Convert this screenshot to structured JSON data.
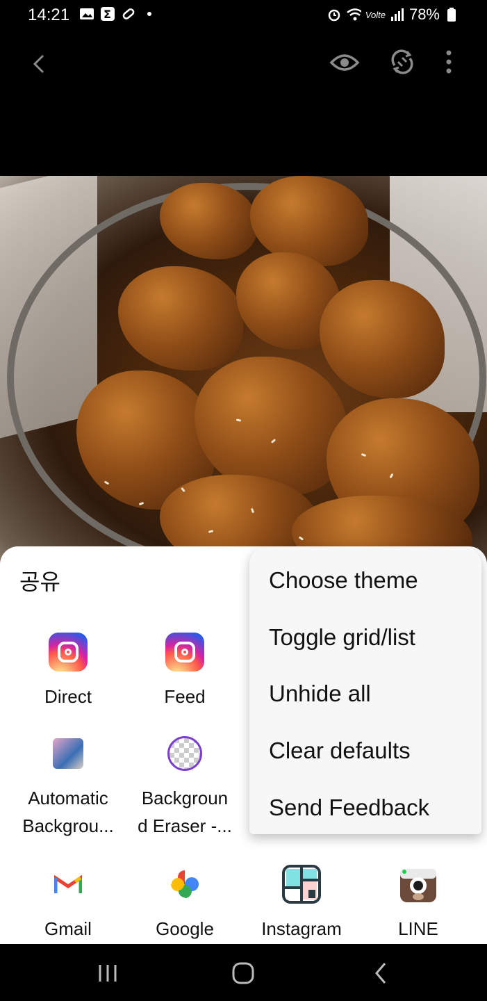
{
  "status_bar": {
    "time": "14:21",
    "battery": "78%",
    "network": "Volte"
  },
  "share_sheet": {
    "title": "공유",
    "apps": [
      {
        "label": "Direct",
        "icon": "instagram-icon"
      },
      {
        "label": "Feed",
        "icon": "instagram-icon"
      },
      {
        "label_line1": "Automatic",
        "label_line2": "Backgrou...",
        "icon": "automatic-background-app-icon"
      },
      {
        "label_line1": "Backgroun",
        "label_line2": "d Eraser -...",
        "icon": "background-eraser-icon"
      },
      {
        "label": "Gmail",
        "icon": "gmail-icon"
      },
      {
        "label": "Google",
        "icon": "google-photos-icon"
      },
      {
        "label": "Instagram",
        "icon": "instagram-layout-icon"
      },
      {
        "label": "LINE",
        "icon": "line-camera-icon"
      }
    ]
  },
  "overflow_menu": {
    "items": [
      "Choose theme",
      "Toggle grid/list",
      "Unhide all",
      "Clear defaults",
      "Send Feedback"
    ]
  },
  "colors": {
    "background": "#000000",
    "sheet": "#ffffff",
    "menu": "#f7f7f7"
  }
}
